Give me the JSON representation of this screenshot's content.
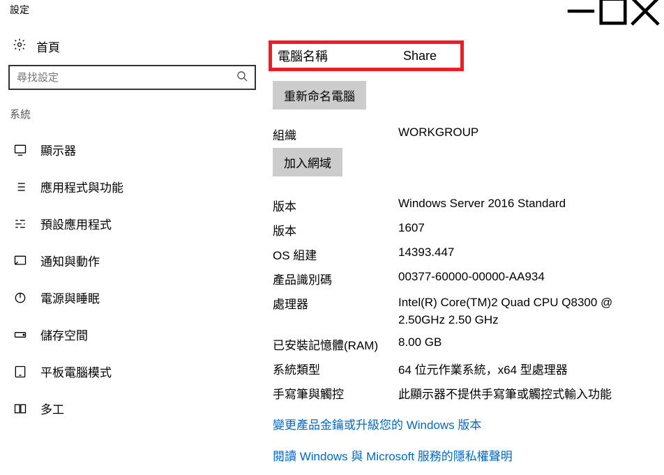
{
  "titlebar": {
    "title": "設定"
  },
  "sidebar": {
    "home_label": "首頁",
    "search_placeholder": "尋找設定",
    "section_label": "系統",
    "items": [
      {
        "label": "顯示器"
      },
      {
        "label": "應用程式與功能"
      },
      {
        "label": "預設應用程式"
      },
      {
        "label": "通知與動作"
      },
      {
        "label": "電源與睡眠"
      },
      {
        "label": "儲存空間"
      },
      {
        "label": "平板電腦模式"
      },
      {
        "label": "多工"
      }
    ]
  },
  "main": {
    "highlight": {
      "label": "電腦名稱",
      "value": "Share"
    },
    "rename_button": "重新命名電腦",
    "org_label": "組織",
    "org_value": "WORKGROUP",
    "join_domain_button": "加入網域",
    "specs": [
      {
        "label": "版本",
        "value": "Windows Server 2016 Standard"
      },
      {
        "label": "版本",
        "value": "1607"
      },
      {
        "label": "OS 組建",
        "value": "14393.447"
      },
      {
        "label": "產品識別碼",
        "value": "00377-60000-00000-AA934"
      },
      {
        "label": "處理器",
        "value": "Intel(R) Core(TM)2 Quad CPU    Q8300 @ 2.50GHz   2.50 GHz"
      },
      {
        "label": "已安裝記憶體(RAM)",
        "value": "8.00 GB"
      },
      {
        "label": "系統類型",
        "value": "64 位元作業系統，x64 型處理器"
      },
      {
        "label": "手寫筆與觸控",
        "value": "此顯示器不提供手寫筆或觸控式輸入功能"
      }
    ],
    "link1": "變更產品金鑰或升級您的 Windows 版本",
    "link2": "閱讀 Windows 與 Microsoft 服務的隱私權聲明"
  }
}
